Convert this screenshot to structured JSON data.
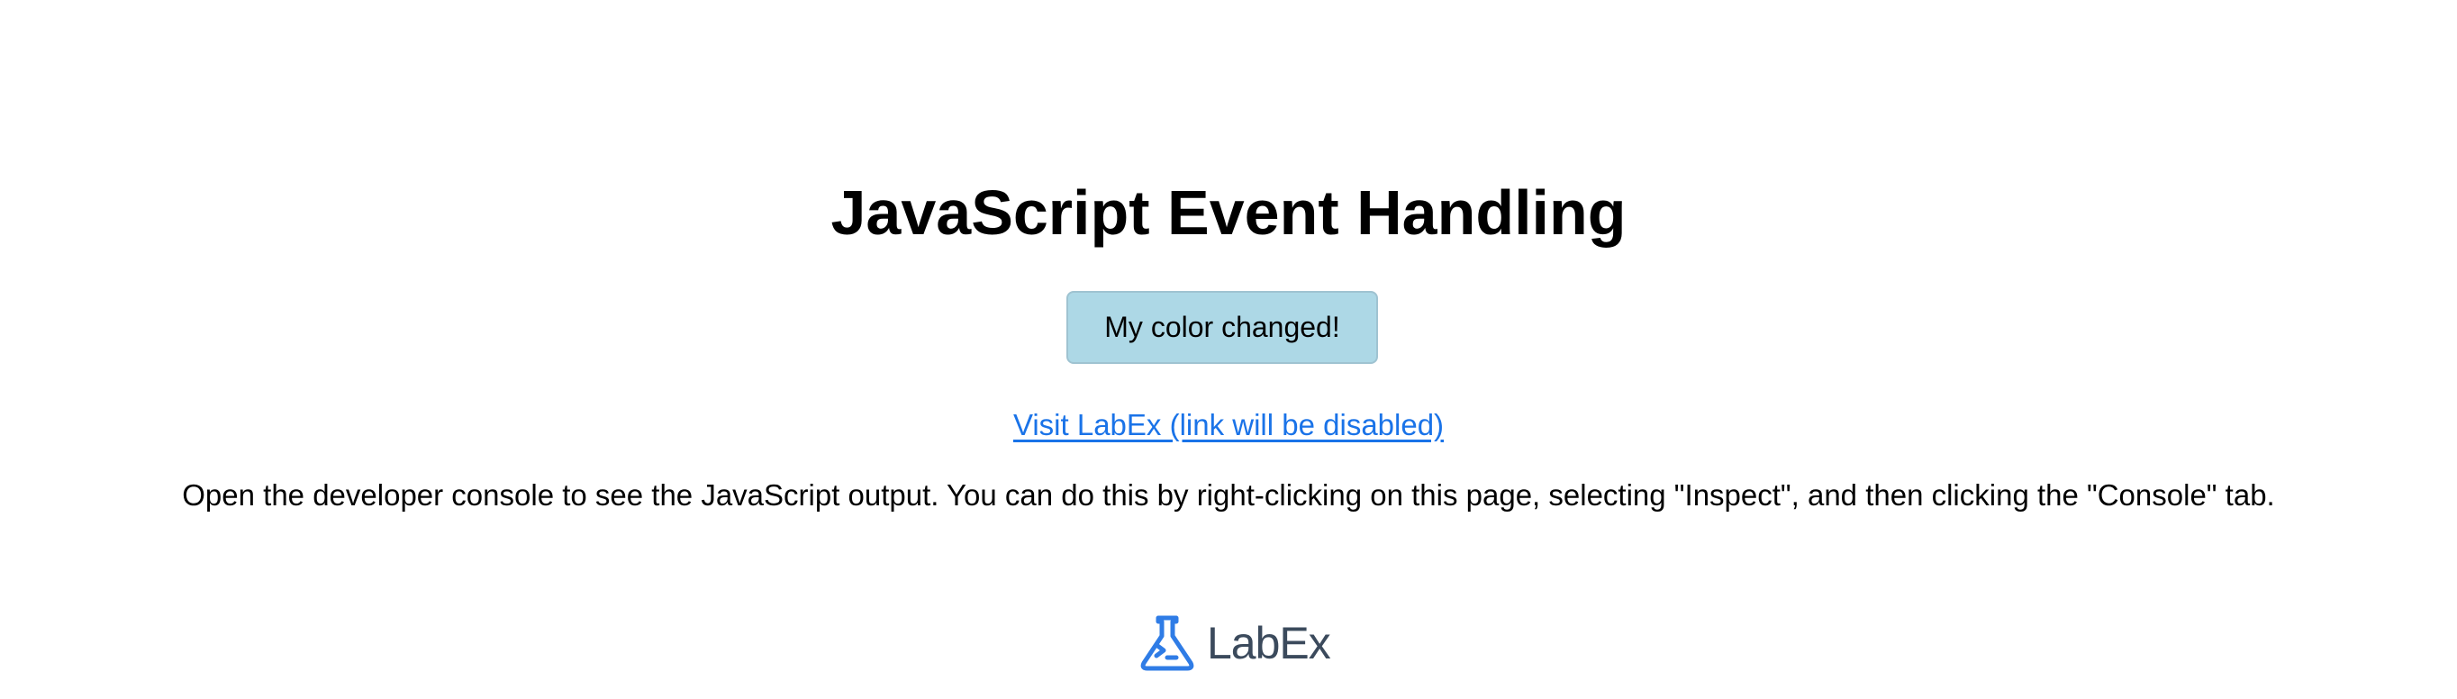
{
  "page": {
    "title": "JavaScript Event Handling",
    "button_label": "My color changed!",
    "link_text": "Visit LabEx (link will be disabled)",
    "instructions": "Open the developer console to see the JavaScript output. You can do this by right-clicking on this page, selecting \"Inspect\", and then clicking the \"Console\" tab."
  },
  "logo": {
    "text": "LabEx",
    "icon": "labex-flask-icon",
    "icon_color": "#2f7ce6",
    "text_color": "#3b4a5c"
  },
  "colors": {
    "button_background": "#add8e6",
    "link": "#1a73e8"
  }
}
